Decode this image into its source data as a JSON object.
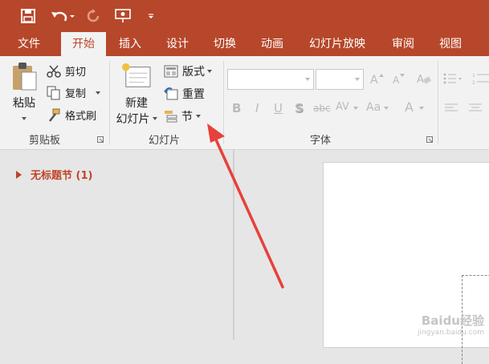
{
  "qat": {
    "save_icon": "save-icon",
    "undo_icon": "undo-icon",
    "redo_icon": "redo-icon",
    "present_icon": "present-from-beginning-icon",
    "customize_icon": "customize-qat-icon"
  },
  "tabs": [
    {
      "label": "文件"
    },
    {
      "label": "开始"
    },
    {
      "label": "插入"
    },
    {
      "label": "设计"
    },
    {
      "label": "切换"
    },
    {
      "label": "动画"
    },
    {
      "label": "幻灯片放映"
    },
    {
      "label": "审阅"
    },
    {
      "label": "视图"
    }
  ],
  "clipboard": {
    "paste": "粘贴",
    "cut": "剪切",
    "copy": "复制",
    "format_painter": "格式刷",
    "group_label": "剪贴板"
  },
  "slides": {
    "new_line1": "新建",
    "new_line2": "幻灯片",
    "layout": "版式",
    "reset": "重置",
    "section": "节",
    "group_label": "幻灯片"
  },
  "font": {
    "group_label": "字体",
    "font_name": "",
    "font_size": "",
    "bold": "B",
    "italic": "I",
    "underline": "U",
    "shadow": "S",
    "strikethrough": "abc",
    "spacing": "AV",
    "case": "Aa",
    "color": "A"
  },
  "thumbnails": {
    "section_title": "无标题节 (1)"
  },
  "watermark": {
    "brand": "Baidu经验",
    "url": "jingyan.baidu.com"
  },
  "colors": {
    "accent": "#b7472a",
    "annotation": "#e8403a"
  }
}
